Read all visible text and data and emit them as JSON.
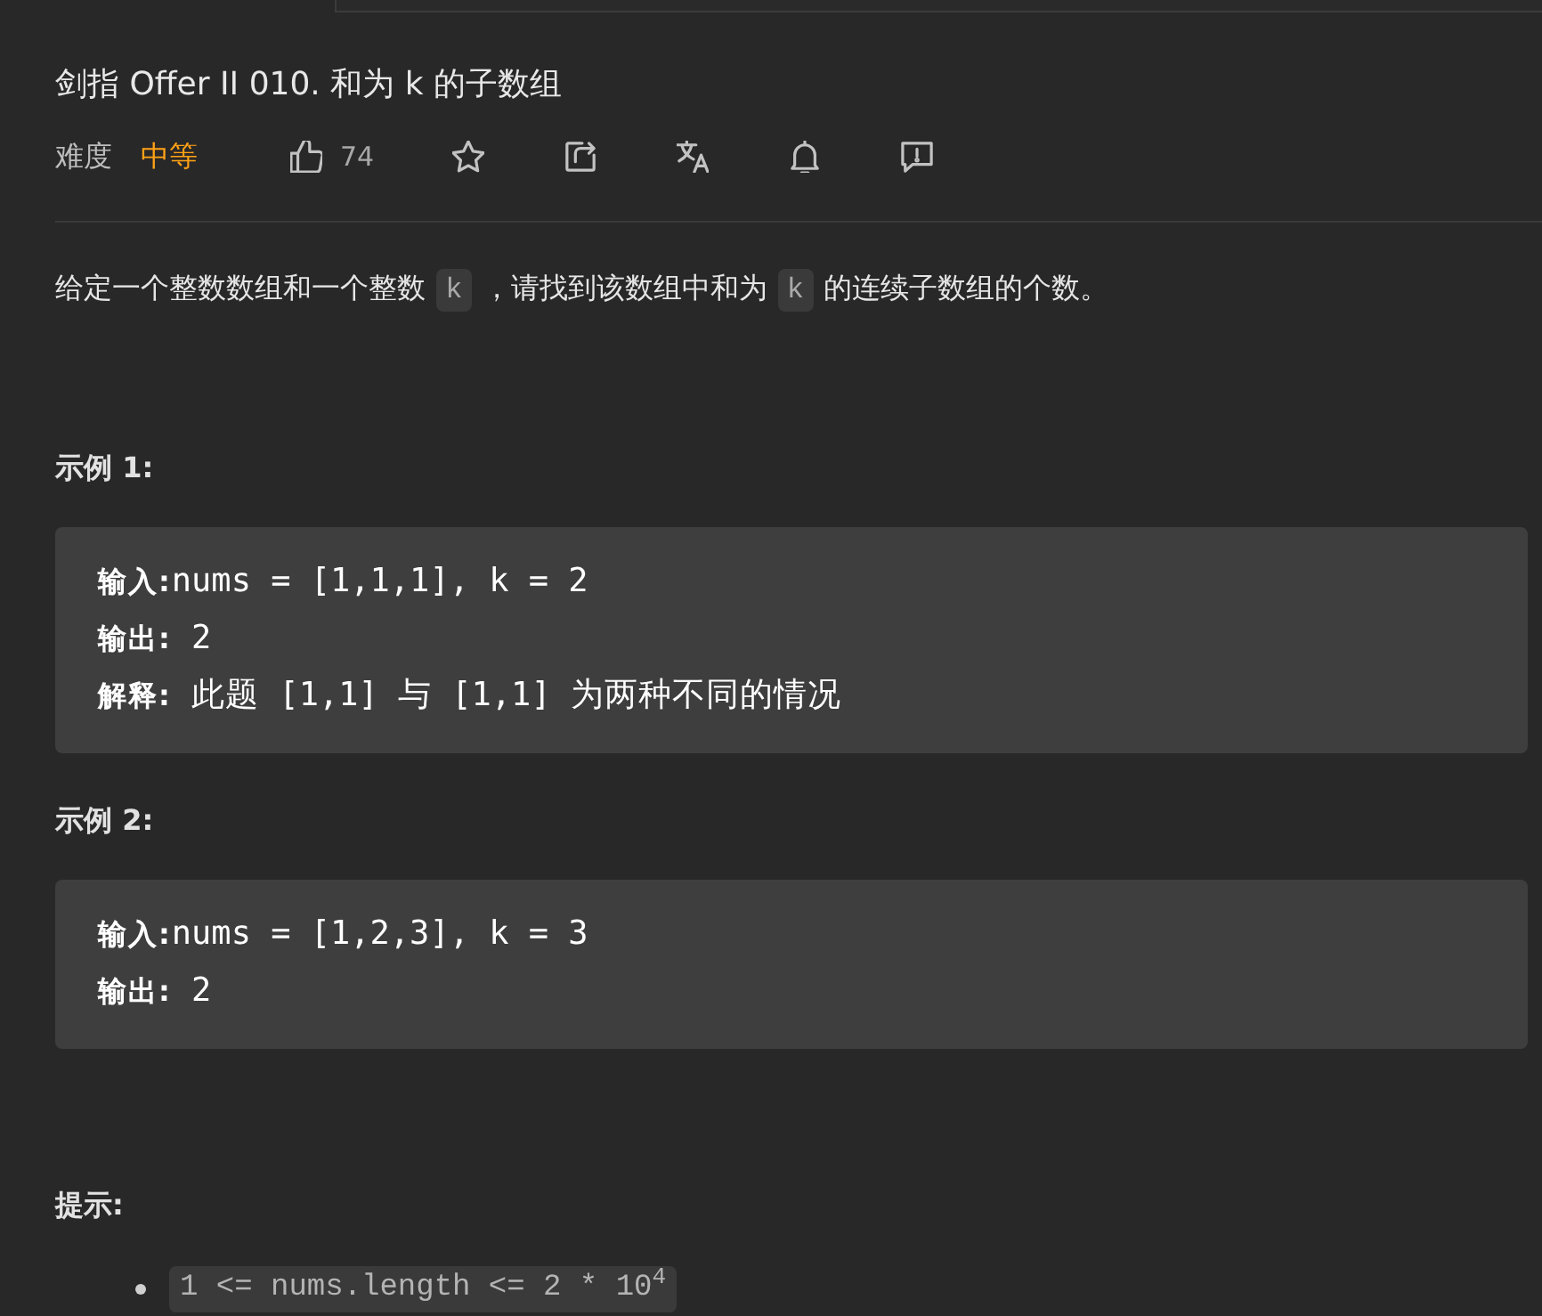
{
  "title": "剑指 Offer II 010. 和为 k 的子数组",
  "meta": {
    "difficulty_label": "难度",
    "difficulty": "中等",
    "likes": "74"
  },
  "description": [
    {
      "kind": "text",
      "text": "给定一个整数数组和一个整数"
    },
    {
      "kind": "code",
      "text": "k"
    },
    {
      "kind": "text",
      "text": "，请找到该数组中和为"
    },
    {
      "kind": "code",
      "text": "k"
    },
    {
      "kind": "text",
      "text": "的连续子数组的个数。"
    }
  ],
  "examples": [
    {
      "heading": "示例 1:",
      "lines": [
        "**输入:**nums = [1,1,1], k = 2",
        "**输出:** 2",
        "**解释:** 此题 [1,1] 与 [1,1] 为两种不同的情况"
      ]
    },
    {
      "heading": "示例 2:",
      "lines": [
        "**输入:**nums = [1,2,3], k = 3",
        "**输出:** 2"
      ]
    }
  ],
  "hints": {
    "heading": "提示:",
    "items": [
      "1 <= nums.length <= 2 * 10$^{4}$"
    ]
  }
}
